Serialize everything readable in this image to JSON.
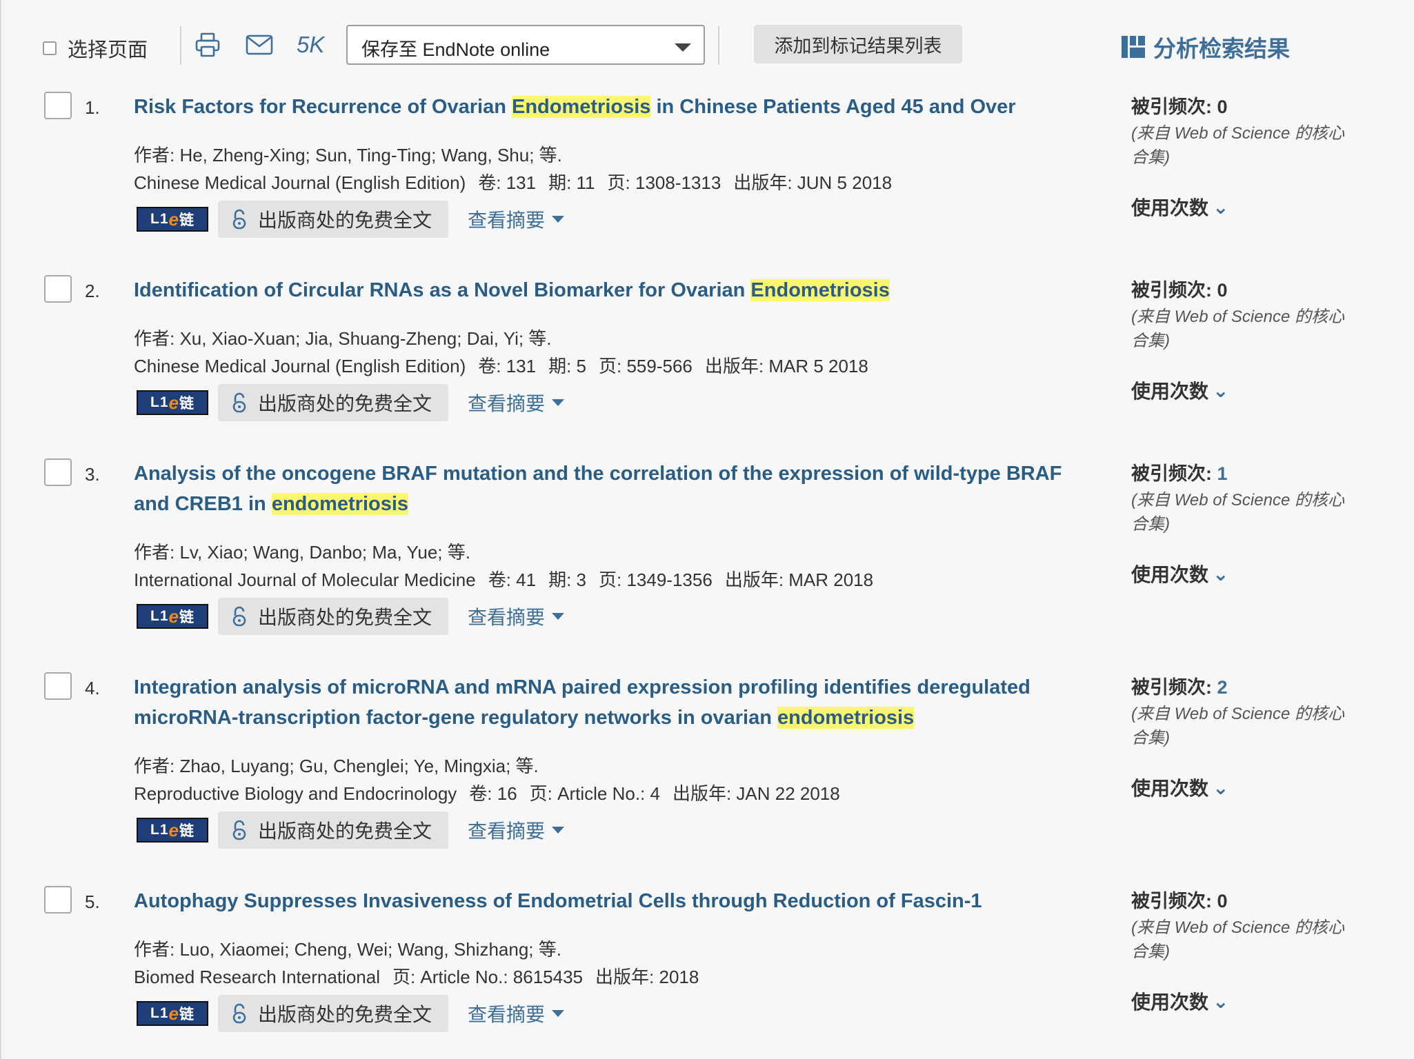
{
  "toolbar": {
    "select_page_label": "选择页面",
    "fivek_label": "5K",
    "endnote_select_value": "保存至 EndNote online",
    "add_marked_label": "添加到标记结果列表",
    "analyze_label": "分析检索结果"
  },
  "labels": {
    "cited_prefix": "被引频次:",
    "cited_source": "(来自 Web of Science 的核心合集)",
    "usage": "使用次数",
    "free_fulltext": "出版商处的免费全文",
    "view_abstract": "查看摘要",
    "elink": "链"
  },
  "records": [
    {
      "num": "1.",
      "title_before": "Risk Factors for Recurrence of Ovarian ",
      "title_highlight": "Endometriosis",
      "title_after": " in Chinese Patients Aged 45 and Over",
      "authors": "作者: He, Zheng-Xing; Sun, Ting-Ting; Wang, Shu; 等.",
      "journal": "Chinese Medical Journal (English Edition)",
      "volume": "卷: 131",
      "issue": "期: 11",
      "pages": "页: 1308-1313",
      "published": "出版年: JUN 5 2018",
      "citations": "0"
    },
    {
      "num": "2.",
      "title_before": "Identification of Circular RNAs as a Novel Biomarker for Ovarian ",
      "title_highlight": "Endometriosis",
      "title_after": "",
      "authors": "作者: Xu, Xiao-Xuan; Jia, Shuang-Zheng; Dai, Yi; 等.",
      "journal": "Chinese Medical Journal (English Edition)",
      "volume": "卷: 131",
      "issue": "期: 5",
      "pages": "页: 559-566",
      "published": "出版年: MAR 5 2018",
      "citations": "0"
    },
    {
      "num": "3.",
      "title_before": "Analysis of the oncogene BRAF mutation and the correlation of the expression of wild-type BRAF and CREB1 in ",
      "title_highlight": "endometriosis",
      "title_after": "",
      "authors": "作者: Lv, Xiao; Wang, Danbo; Ma, Yue; 等.",
      "journal": "International Journal of Molecular Medicine",
      "volume": "卷: 41",
      "issue": "期: 3",
      "pages": "页: 1349-1356",
      "published": "出版年: MAR 2018",
      "citations": "1"
    },
    {
      "num": "4.",
      "title_before": "Integration analysis of microRNA and mRNA paired expression profiling identifies deregulated microRNA-transcription factor-gene regulatory networks in ovarian ",
      "title_highlight": "endometriosis",
      "title_after": "",
      "authors": "作者: Zhao, Luyang; Gu, Chenglei; Ye, Mingxia; 等.",
      "journal": "Reproductive Biology and Endocrinology",
      "volume": "卷: 16",
      "issue": "",
      "pages": "页: Article No.: 4",
      "published": "出版年: JAN 22 2018",
      "citations": "2"
    },
    {
      "num": "5.",
      "title_before": "Autophagy Suppresses Invasiveness of Endometrial Cells through Reduction of Fascin-1",
      "title_highlight": "",
      "title_after": "",
      "authors": "作者: Luo, Xiaomei; Cheng, Wei; Wang, Shizhang; 等.",
      "journal": "Biomed Research International",
      "volume": "",
      "issue": "",
      "pages": "页: Article No.: 8615435",
      "published": "出版年: 2018",
      "citations": "0"
    }
  ]
}
